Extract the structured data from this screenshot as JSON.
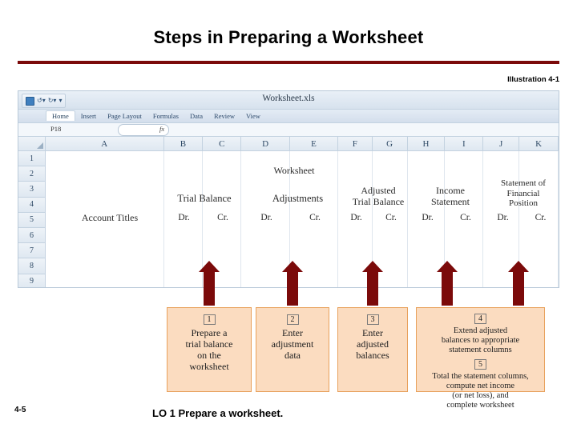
{
  "slide": {
    "title": "Steps in Preparing a Worksheet",
    "illustration_label": "Illustration 4-1",
    "page_number": "4-5",
    "footer": "LO 1  Prepare a worksheet.",
    "accent_color": "#7B0A0A",
    "stepbox_fill": "#FBDCC0",
    "stepbox_border": "#E8A15C"
  },
  "spreadsheet": {
    "document_title": "Worksheet.xls",
    "quick_access": [
      "save-icon",
      "undo-icon",
      "redo-icon",
      "customize-icon"
    ],
    "ribbon_tabs": [
      {
        "label": "Home",
        "active": true
      },
      {
        "label": "Insert",
        "active": false
      },
      {
        "label": "Page Layout",
        "active": false
      },
      {
        "label": "Formulas",
        "active": false
      },
      {
        "label": "Data",
        "active": false
      },
      {
        "label": "Review",
        "active": false
      },
      {
        "label": "View",
        "active": false
      }
    ],
    "name_box": "P18",
    "formula_label": "fx",
    "formula_value": "",
    "column_headers": [
      "A",
      "B",
      "C",
      "D",
      "E",
      "F",
      "G",
      "H",
      "I",
      "J",
      "K"
    ],
    "row_headers": [
      "1",
      "2",
      "3",
      "4",
      "5",
      "6",
      "7",
      "8",
      "9"
    ],
    "sheet_title": "Worksheet",
    "section_headers": [
      {
        "label": "Trial Balance"
      },
      {
        "label": "Adjustments"
      },
      {
        "label": "Adjusted\nTrial Balance"
      },
      {
        "label": "Income\nStatement"
      },
      {
        "label": "Statement of\nFinancial\nPosition"
      }
    ],
    "account_titles_label": "Account Titles",
    "dr_cr_labels": [
      "Dr.",
      "Cr.",
      "Dr.",
      "Cr.",
      "Dr.",
      "Cr.",
      "Dr.",
      "Cr.",
      "Dr.",
      "Cr."
    ]
  },
  "steps": [
    {
      "number": "1",
      "text": "Prepare a\ntrial balance\non the\nworksheet"
    },
    {
      "number": "2",
      "text": "Enter\nadjustment\ndata"
    },
    {
      "number": "3",
      "text": "Enter\nadjusted\nbalances"
    },
    {
      "number": "4",
      "text": "Extend adjusted\nbalances to appropriate\nstatement columns"
    },
    {
      "number": "5",
      "text": "Total the statement columns,\ncompute net income\n(or net loss), and\ncomplete worksheet"
    }
  ]
}
